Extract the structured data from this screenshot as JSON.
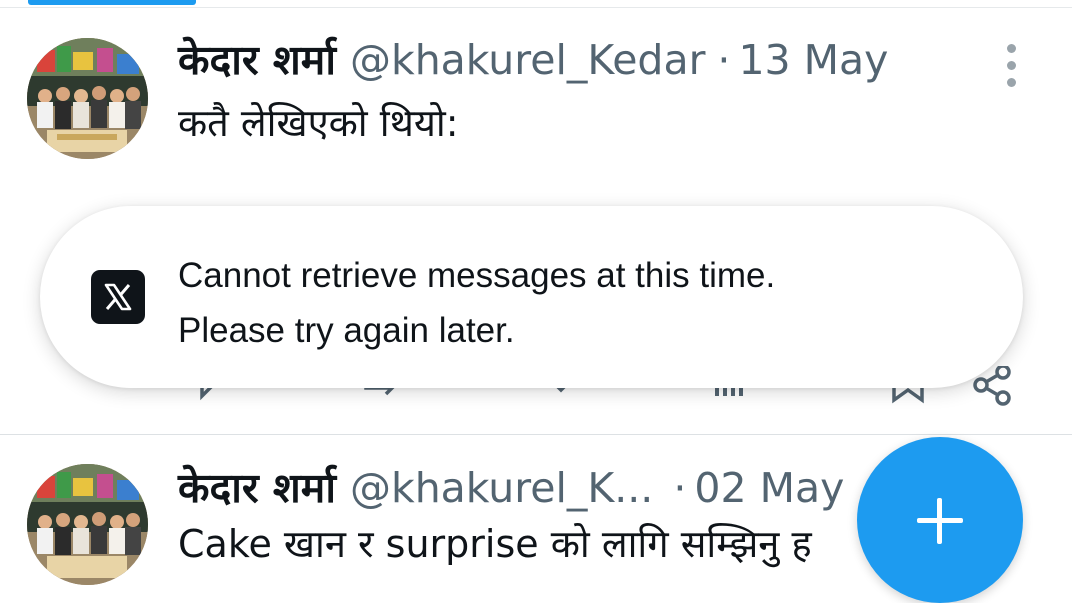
{
  "tweets": [
    {
      "name": "केदार शर्मा",
      "handle": "@khakurel_Kedar",
      "separator": "·",
      "date": "13 May",
      "text": "कतै लेखिएको थियो:"
    },
    {
      "name": "केदार शर्मा",
      "handle": "@khakurel_K...",
      "separator": "·",
      "date": "02 May",
      "text": "Cake खान र surprise को लागि सम्झिनु ह"
    }
  ],
  "toast": {
    "logo": "x-logo-icon",
    "line1": "Cannot retrieve messages at this time.",
    "line2": "Please try again later."
  },
  "fab": {
    "icon": "plus-icon"
  },
  "colors": {
    "accent": "#1d9bf0",
    "text": "#0f1419",
    "secondary": "#536471"
  }
}
